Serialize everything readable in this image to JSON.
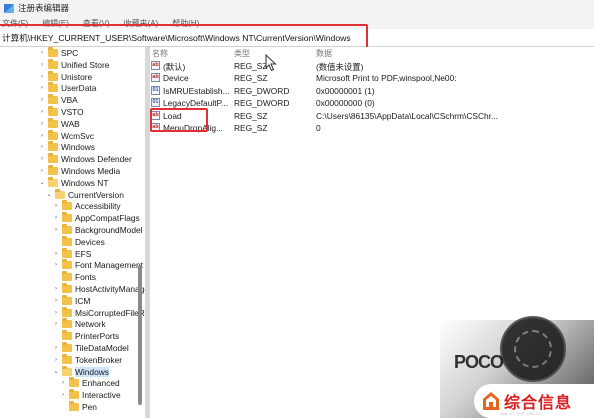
{
  "window": {
    "title": "注册表编辑器"
  },
  "menu": [
    {
      "label": "文件(F)"
    },
    {
      "label": "编辑(E)"
    },
    {
      "label": "查看(V)"
    },
    {
      "label": "收藏夹(A)"
    },
    {
      "label": "帮助(H)"
    }
  ],
  "address": {
    "path": "计算机\\HKEY_CURRENT_USER\\Software\\Microsoft\\Windows NT\\CurrentVersion\\Windows"
  },
  "tree": {
    "items": [
      {
        "label": "SPC",
        "expander": "›",
        "open": false
      },
      {
        "label": "Unified Store",
        "expander": "›",
        "open": false
      },
      {
        "label": "Unistore",
        "expander": "›",
        "open": false
      },
      {
        "label": "UserData",
        "expander": "›",
        "open": false
      },
      {
        "label": "VBA",
        "expander": "›",
        "open": false
      },
      {
        "label": "VSTO",
        "expander": "›",
        "open": false
      },
      {
        "label": "WAB",
        "expander": "›",
        "open": false
      },
      {
        "label": "WcmSvc",
        "expander": "›",
        "open": false
      },
      {
        "label": "Windows",
        "expander": "›",
        "open": false
      },
      {
        "label": "Windows Defender",
        "expander": "›",
        "open": false
      },
      {
        "label": "Windows Media",
        "expander": "›",
        "open": false
      },
      {
        "label": "Windows NT",
        "expander": "⌄",
        "open": true
      },
      {
        "label": "CurrentVersion",
        "expander": "⌄",
        "open": true
      },
      {
        "label": "Accessibility",
        "expander": "›",
        "open": false
      },
      {
        "label": "AppCompatFlags",
        "expander": "›",
        "open": false
      },
      {
        "label": "BackgroundModel",
        "expander": "›",
        "open": false
      },
      {
        "label": "Devices",
        "expander": "",
        "open": false
      },
      {
        "label": "EFS",
        "expander": "›",
        "open": false
      },
      {
        "label": "Font Management",
        "expander": "›",
        "open": false
      },
      {
        "label": "Fonts",
        "expander": "",
        "open": false
      },
      {
        "label": "HostActivityManager",
        "expander": "›",
        "open": false
      },
      {
        "label": "ICM",
        "expander": "›",
        "open": false
      },
      {
        "label": "MsiCorruptedFileRecovery",
        "expander": "›",
        "open": false
      },
      {
        "label": "Network",
        "expander": "›",
        "open": false
      },
      {
        "label": "PrinterPorts",
        "expander": "",
        "open": false
      },
      {
        "label": "TileDataModel",
        "expander": "›",
        "open": false
      },
      {
        "label": "TokenBroker",
        "expander": "›",
        "open": false
      },
      {
        "label": "Windows",
        "expander": "⌄",
        "open": true,
        "selected": true
      },
      {
        "label": "Enhanced",
        "expander": "›",
        "open": false
      },
      {
        "label": "Interactive",
        "expander": "›",
        "open": false
      },
      {
        "label": "Pen",
        "expander": "",
        "open": false
      }
    ]
  },
  "list": {
    "headers": {
      "name": "名称",
      "type": "类型",
      "data": "数据"
    },
    "rows": [
      {
        "icon": "string-value-icon",
        "glyph": "ab",
        "name": "(默认)",
        "type": "REG_SZ",
        "data": "(数值未设置)"
      },
      {
        "icon": "string-value-icon",
        "glyph": "ab",
        "name": "Device",
        "type": "REG_SZ",
        "data": "Microsoft Print to PDF,winspool,Ne00:"
      },
      {
        "icon": "binary-value-icon",
        "glyph": "01",
        "name": "IsMRUEstablish...",
        "type": "REG_DWORD",
        "data": "0x00000001 (1)"
      },
      {
        "icon": "binary-value-icon",
        "glyph": "01",
        "name": "LegacyDefaultP...",
        "type": "REG_DWORD",
        "data": "0x00000000 (0)"
      },
      {
        "icon": "string-value-icon",
        "glyph": "ab",
        "name": "Load",
        "type": "REG_SZ",
        "data": "C:\\Users\\86135\\AppData\\Local\\CSchrm\\CSChr..."
      },
      {
        "icon": "string-value-icon",
        "glyph": "ab",
        "name": "MenuDropAlig...",
        "type": "REG_SZ",
        "data": "0"
      }
    ]
  },
  "watermark": {
    "brand": "综合信息",
    "partial": "POCO",
    "url": "www.mfsnet.com.cn"
  },
  "colors": {
    "highlight": "#e03030",
    "folder": "#f3c24a",
    "brand": "#d81e1e"
  }
}
